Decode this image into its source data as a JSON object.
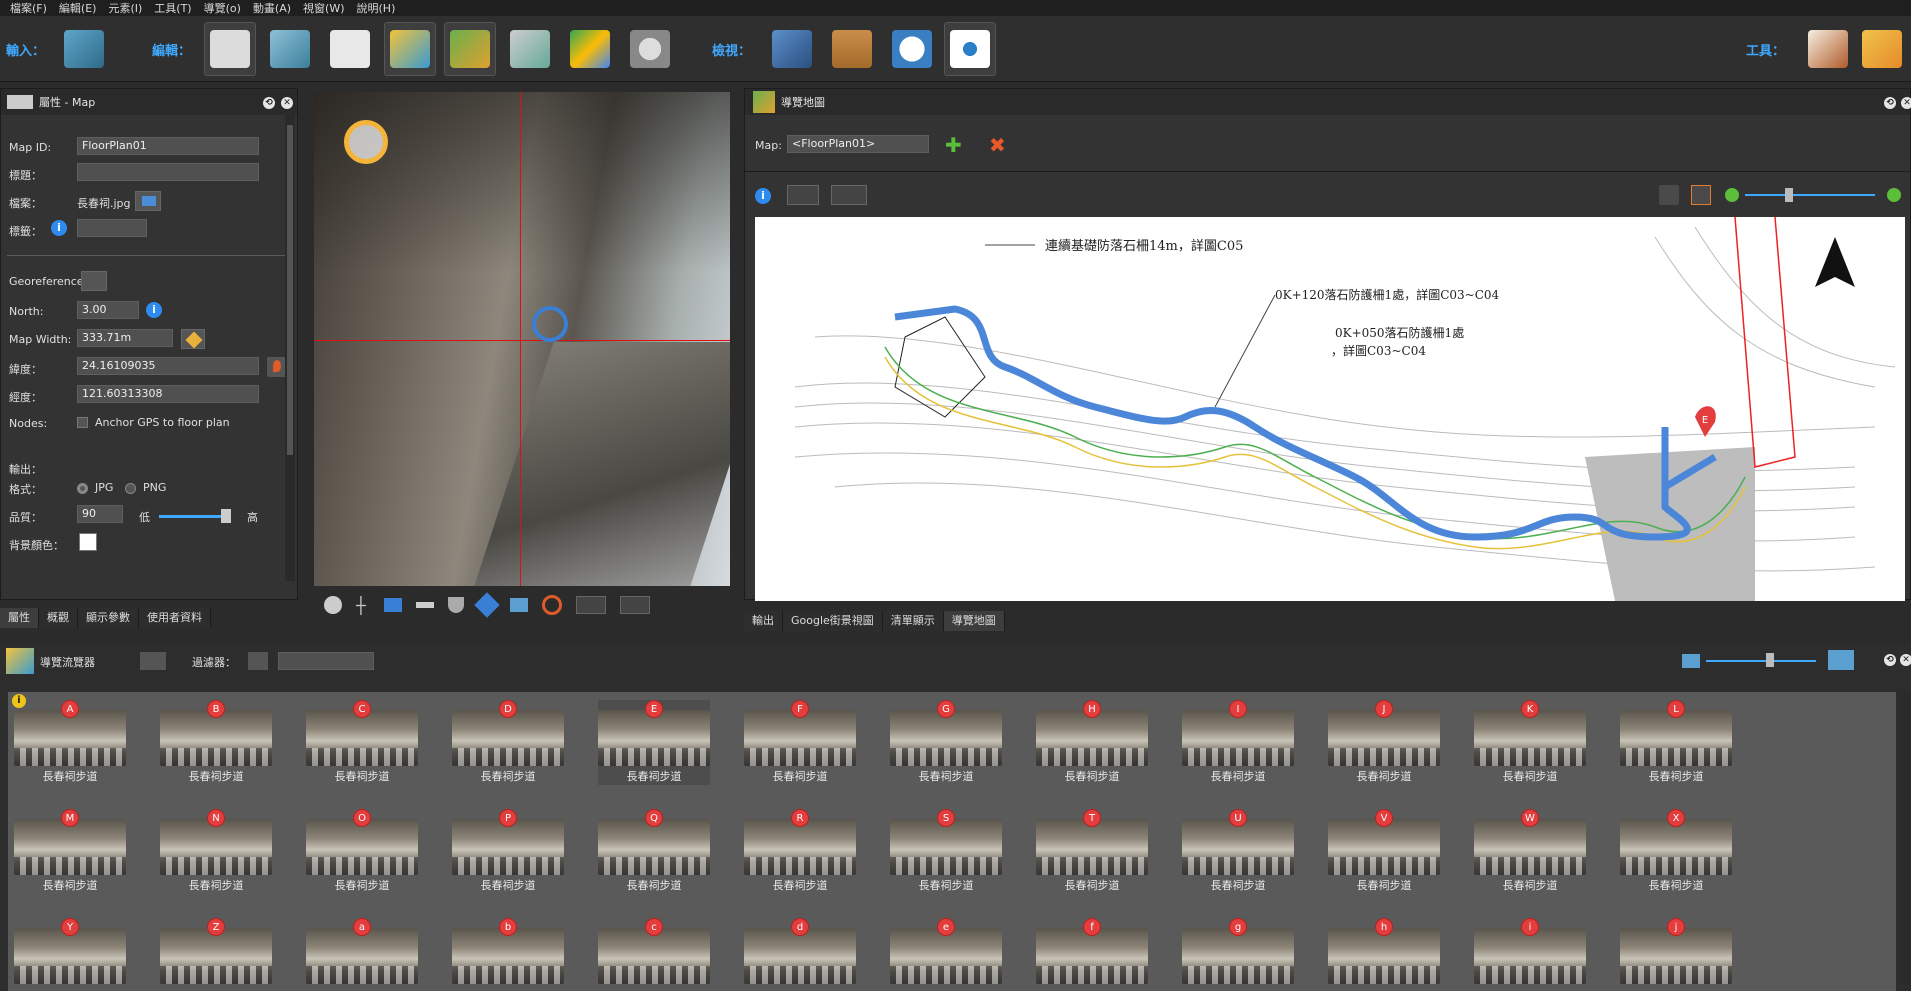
{
  "menu": [
    "檔案(F)",
    "編輯(E)",
    "元素(I)",
    "工具(T)",
    "導覽(o)",
    "動畫(A)",
    "視窗(W)",
    "說明(H)"
  ],
  "toolbar": {
    "input_label": "輸入：",
    "edit_label": "編輯：",
    "view_label": "檢視：",
    "tools_label": "工具："
  },
  "props": {
    "title": "屬性 - Map",
    "map_id_label": "Map ID:",
    "map_id": "FloorPlan01",
    "caption_label": "標題：",
    "caption": "",
    "file_label": "檔案：",
    "file": "長春祠.jpg",
    "tag_label": "標籤：",
    "georef_label": "Georeference:",
    "north_label": "North:",
    "north": "3.00",
    "mapwidth_label": "Map Width:",
    "mapwidth": "333.71m",
    "lat_label": "緯度：",
    "lat": "24.16109035",
    "lon_label": "經度：",
    "lon": "121.60313308",
    "nodes_label": "Nodes:",
    "anchor": "Anchor GPS to floor plan",
    "output_label": "輸出：",
    "format_label": "格式：",
    "jpg": "JPG",
    "png": "PNG",
    "quality_label": "品質：",
    "quality": "90",
    "low": "低",
    "high": "高",
    "bg_label": "背景顏色："
  },
  "left_tabs": [
    "屬性",
    "概觀",
    "顯示參數",
    "使用者資料"
  ],
  "map": {
    "title": "導覽地圖",
    "map_label": "Map:",
    "map_select": "<FloorPlan01>",
    "annotations": [
      "連續基礎防落石柵14m，詳圖C05",
      "0K+120落石防護柵1處，詳圖C03~C04",
      "0K+050落石防護柵1處",
      "，詳圖C03~C04"
    ],
    "marker": "E",
    "tabs": [
      "輸出",
      "Google街景視圖",
      "清單顯示",
      "導覽地圖"
    ]
  },
  "browser": {
    "title": "導覽流覽器",
    "filter_label": "過濾器："
  },
  "thumbs": [
    {
      "id": "A",
      "cap": "長春祠步道"
    },
    {
      "id": "B",
      "cap": "長春祠步道"
    },
    {
      "id": "C",
      "cap": "長春祠步道"
    },
    {
      "id": "D",
      "cap": "長春祠步道"
    },
    {
      "id": "E",
      "cap": "長春祠步道"
    },
    {
      "id": "F",
      "cap": "長春祠步道"
    },
    {
      "id": "G",
      "cap": "長春祠步道"
    },
    {
      "id": "H",
      "cap": "長春祠步道"
    },
    {
      "id": "I",
      "cap": "長春祠步道"
    },
    {
      "id": "J",
      "cap": "長春祠步道"
    },
    {
      "id": "K",
      "cap": "長春祠步道"
    },
    {
      "id": "L",
      "cap": "長春祠步道"
    },
    {
      "id": "M",
      "cap": "長春祠步道"
    },
    {
      "id": "N",
      "cap": "長春祠步道"
    },
    {
      "id": "O",
      "cap": "長春祠步道"
    },
    {
      "id": "P",
      "cap": "長春祠步道"
    },
    {
      "id": "Q",
      "cap": "長春祠步道"
    },
    {
      "id": "R",
      "cap": "長春祠步道"
    },
    {
      "id": "S",
      "cap": "長春祠步道"
    },
    {
      "id": "T",
      "cap": "長春祠步道"
    },
    {
      "id": "U",
      "cap": "長春祠步道"
    },
    {
      "id": "V",
      "cap": "長春祠步道"
    },
    {
      "id": "W",
      "cap": "長春祠步道"
    },
    {
      "id": "X",
      "cap": "長春祠步道"
    },
    {
      "id": "Y",
      "cap": ""
    },
    {
      "id": "Z",
      "cap": ""
    },
    {
      "id": "a",
      "cap": ""
    },
    {
      "id": "b",
      "cap": ""
    },
    {
      "id": "c",
      "cap": ""
    },
    {
      "id": "d",
      "cap": ""
    },
    {
      "id": "e",
      "cap": ""
    },
    {
      "id": "f",
      "cap": ""
    },
    {
      "id": "g",
      "cap": ""
    },
    {
      "id": "h",
      "cap": ""
    },
    {
      "id": "i",
      "cap": ""
    },
    {
      "id": "j",
      "cap": ""
    }
  ],
  "selected_thumb": "E",
  "colors": {
    "accent": "#3fa9ff",
    "badge": "#e33d3d",
    "route": "#4b86d8"
  }
}
